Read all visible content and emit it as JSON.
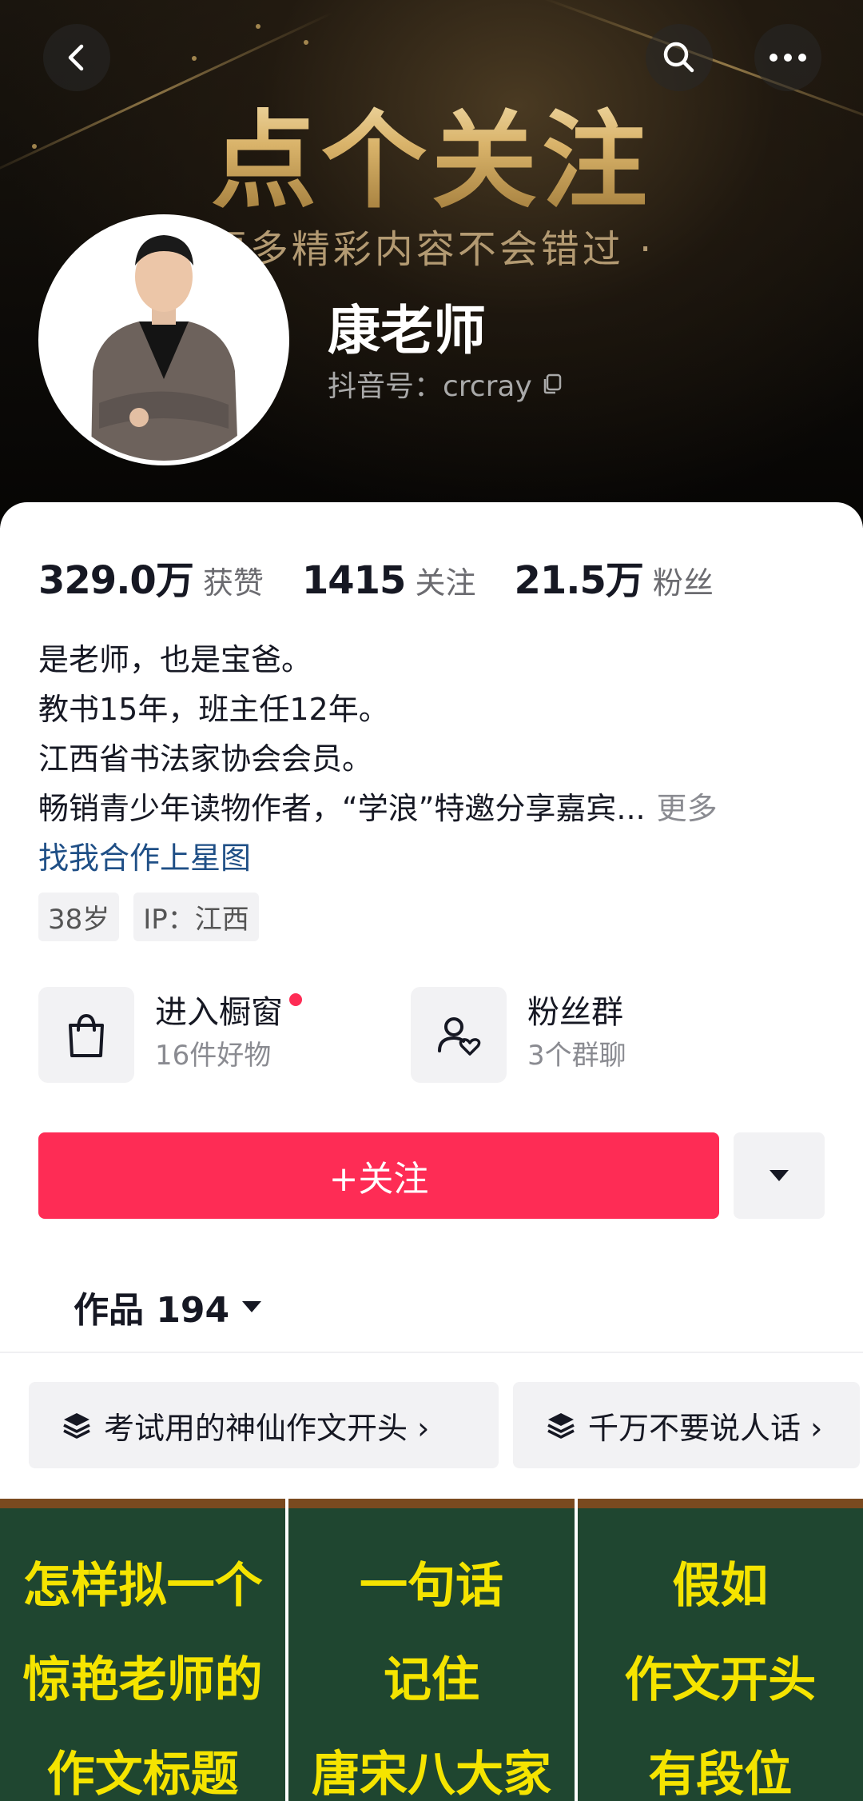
{
  "header": {
    "banner_title": "点个关注",
    "banner_subtitle": "更多精彩内容不会错过 ·",
    "name": "康老师",
    "douyin_id": "抖音号：crcray"
  },
  "stats": [
    {
      "value": "329.0万",
      "label": "获赞"
    },
    {
      "value": "1415",
      "label": "关注"
    },
    {
      "value": "21.5万",
      "label": "粉丝"
    }
  ],
  "bio": {
    "lines": [
      "是老师，也是宝爸。",
      "教书15年，班主任12年。",
      "江西省书法家协会会员。",
      "畅销青少年读物作者，“学浪”特邀分享嘉宾..."
    ],
    "more": "更多",
    "link": "找我合作上星图"
  },
  "tags": [
    "38岁",
    "IP：江西"
  ],
  "quick": {
    "shop": {
      "title": "进入橱窗",
      "sub": "16件好物"
    },
    "fans": {
      "title": "粉丝群",
      "sub": "3个群聊"
    }
  },
  "follow_label": "+关注",
  "works_tab": "作品 194",
  "collections": [
    "考试用的神仙作文开头 ›",
    "千万不要说人话 ›"
  ],
  "videos": [
    {
      "lines": [
        "怎样拟一个",
        "惊艳老师的",
        "作文标题"
      ]
    },
    {
      "lines": [
        "一句话",
        "记住",
        "唐宋八大家"
      ]
    },
    {
      "lines": [
        "假如",
        "作文开头",
        "有段位"
      ]
    }
  ],
  "colors": {
    "accent": "#fe2c55",
    "link": "#1f4f86",
    "tile_bg": "#1f4630",
    "tile_text": "#f5e400"
  }
}
